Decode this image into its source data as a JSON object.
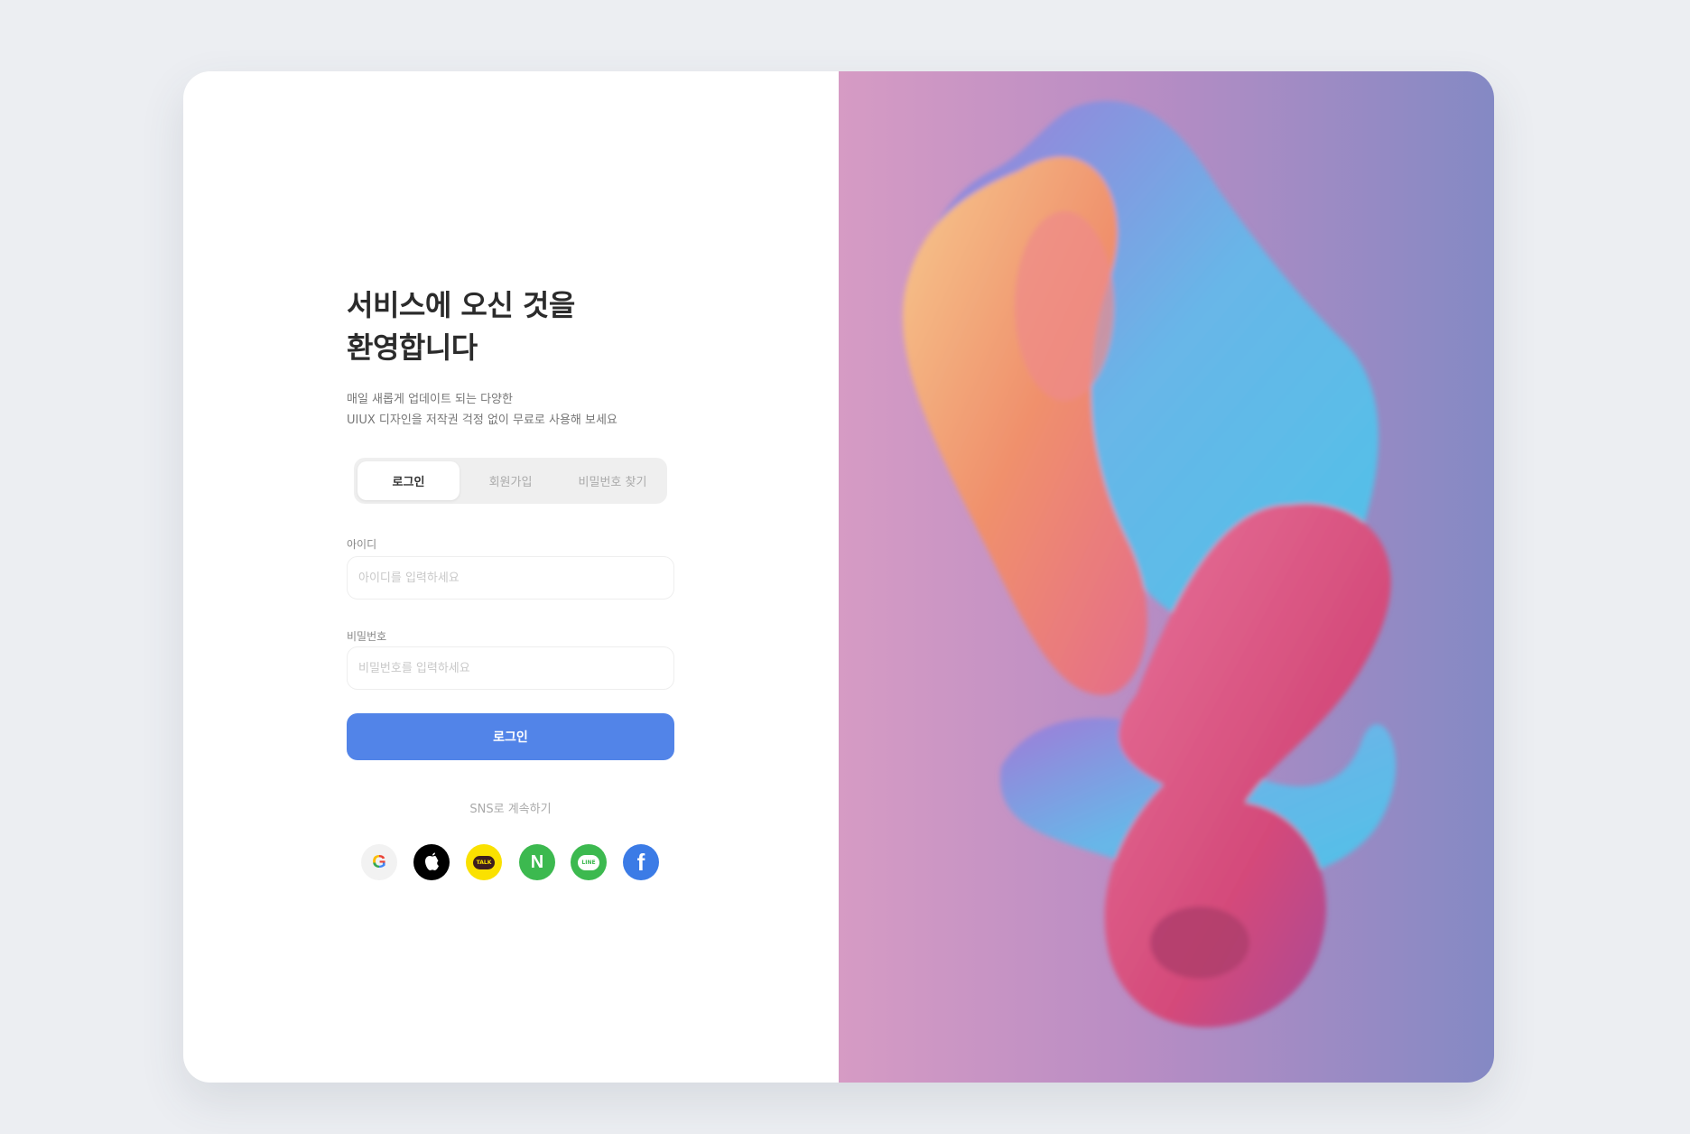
{
  "heading": {
    "line1": "서비스에 오신 것을",
    "line2": "환영합니다"
  },
  "subtitle": {
    "line1": "매일 새롭게 업데이트 되는 다양한",
    "line2": "UIUX 디자인을 저작권 걱정 없이 무료로 사용해 보세요"
  },
  "tabs": [
    {
      "label": "로그인",
      "active": true
    },
    {
      "label": "회원가입"
    },
    {
      "label": "비밀번호 찾기"
    }
  ],
  "form": {
    "id_label": "아이디",
    "id_placeholder": "아이디를 입력하세요",
    "pw_label": "비밀번호",
    "pw_placeholder": "비밀번호를 입력하세요",
    "submit_label": "로그인"
  },
  "sns": {
    "label": "SNS로 계속하기",
    "providers": [
      {
        "name": "google",
        "glyph": "G",
        "color": "#f2f2f2"
      },
      {
        "name": "apple",
        "glyph": "",
        "color": "#000000"
      },
      {
        "name": "kakao",
        "glyph": "TALK",
        "color": "#fae100"
      },
      {
        "name": "naver",
        "glyph": "N",
        "color": "#3cb94f"
      },
      {
        "name": "line",
        "glyph": "LINE",
        "color": "#3cb94f"
      },
      {
        "name": "facebook",
        "glyph": "f",
        "color": "#3b7be6"
      }
    ]
  }
}
